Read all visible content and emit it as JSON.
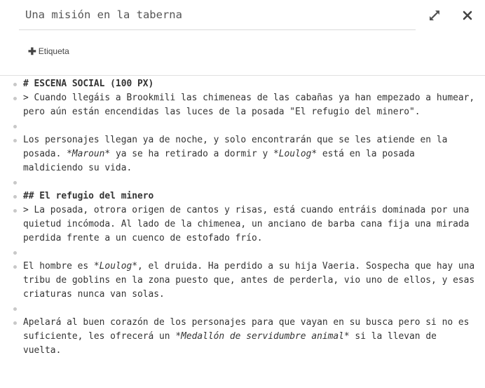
{
  "header": {
    "title_value": "Una misión en la taberna",
    "tag_button_label": "Etiqueta",
    "expand_icon": "expand-arrows-icon",
    "close_icon": "close-x-icon"
  },
  "lines": [
    {
      "text": "# ESCENA SOCIAL (100 PX)"
    },
    {
      "text": "> Cuando llegáis a Brookmili las chimeneas de las cabañas ya han empezado a humear, pero aún están encendidas las luces de la posada \"El refugio del minero\"."
    },
    {
      "text": ""
    },
    {
      "pre": "Los personajes llegan ya de noche, y solo encontrarán que se les atiende en la posada. ",
      "em": "*Maroun*",
      "post": " ya se ha retirado a dormir y ",
      "em2": "*Loulog*",
      "post2": " está en la posada maldiciendo su vida."
    },
    {
      "text": ""
    },
    {
      "text": "## El refugio del minero"
    },
    {
      "text": "> La posada, otrora origen de cantos y risas, está cuando entráis dominada por una quietud incómoda. Al lado de la chimenea, un anciano de barba cana fija una mirada perdida frente a un cuenco de estofado frío."
    },
    {
      "text": ""
    },
    {
      "pre": "El hombre es ",
      "em": "*Loulog*",
      "post": ", el druida. Ha perdido a su hija Vaeria. Sospecha que hay una tribu de goblins en la zona puesto que, antes de perderla, vio uno de ellos, y esas criaturas nunca van solas."
    },
    {
      "text": ""
    },
    {
      "pre": "Apelará al buen corazón de los personajes para que vayan en su busca pero si no es suficiente, les ofrecerá un ",
      "em": "*Medallón de servidumbre animal*",
      "post": " si la llevan de vuelta."
    }
  ]
}
